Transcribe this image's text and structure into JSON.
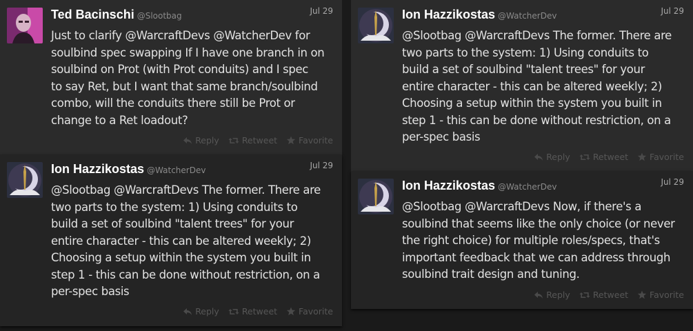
{
  "tweets": [
    {
      "name": "Ted Bacinschi",
      "handle": "@Slootbag",
      "date": "Jul 29",
      "avatar": "person-photo",
      "lines": [
        "Just to clarify @WarcraftDevs @WatcherDev for",
        "soulbind spec swapping If I have one branch in on",
        "soulbind on Prot (with Prot conduits) and I spec",
        "to say Ret, but I want that same branch/soulbind",
        "combo, will the conduits there still be Prot or",
        "change to a Ret loadout?"
      ]
    },
    {
      "name": "Ion Hazzikostas",
      "handle": "@WatcherDev",
      "date": "Jul 29",
      "avatar": "moon-logo",
      "lines": [
        "@Slootbag @WarcraftDevs The former. There are",
        "two parts to the system: 1) Using conduits to",
        "build a set of soulbind \"talent trees\" for your",
        "entire character - this can be altered weekly; 2)",
        "Choosing a setup within the system you built in",
        "step 1 - this can be done without restriction, on a",
        "per-spec basis"
      ]
    },
    {
      "name": "Ion Hazzikostas",
      "handle": "@WatcherDev",
      "date": "Jul 29",
      "avatar": "moon-logo",
      "lines": [
        "@Slootbag @WarcraftDevs The former. There are",
        "two parts to the system: 1) Using conduits to",
        "build a set of soulbind \"talent trees\" for your",
        "entire character - this can be altered weekly; 2)",
        "Choosing a setup within the system you built in",
        "step 1 - this can be done without restriction, on a",
        "per-spec basis"
      ]
    },
    {
      "name": "Ion Hazzikostas",
      "handle": "@WatcherDev",
      "date": "Jul 29",
      "avatar": "moon-logo",
      "lines": [
        "@Slootbag @WarcraftDevs Now, if there's a",
        "soulbind that seems like the only choice (or never",
        "the right choice) for multiple roles/specs, that's",
        "important feedback that we can address through",
        "soulbind trait design and tuning."
      ]
    }
  ],
  "actions": {
    "reply": "Reply",
    "retweet": "Retweet",
    "favorite": "Favorite",
    "reply_icon": "reply-icon",
    "retweet_icon": "retweet-icon",
    "favorite_icon": "star-icon"
  },
  "colors": {
    "background": "#1a1a1a",
    "card": "#2b2b2b",
    "card_alt": "#242424",
    "name": "#ffffff",
    "text": "#e2e2e2",
    "muted": "#575757"
  }
}
